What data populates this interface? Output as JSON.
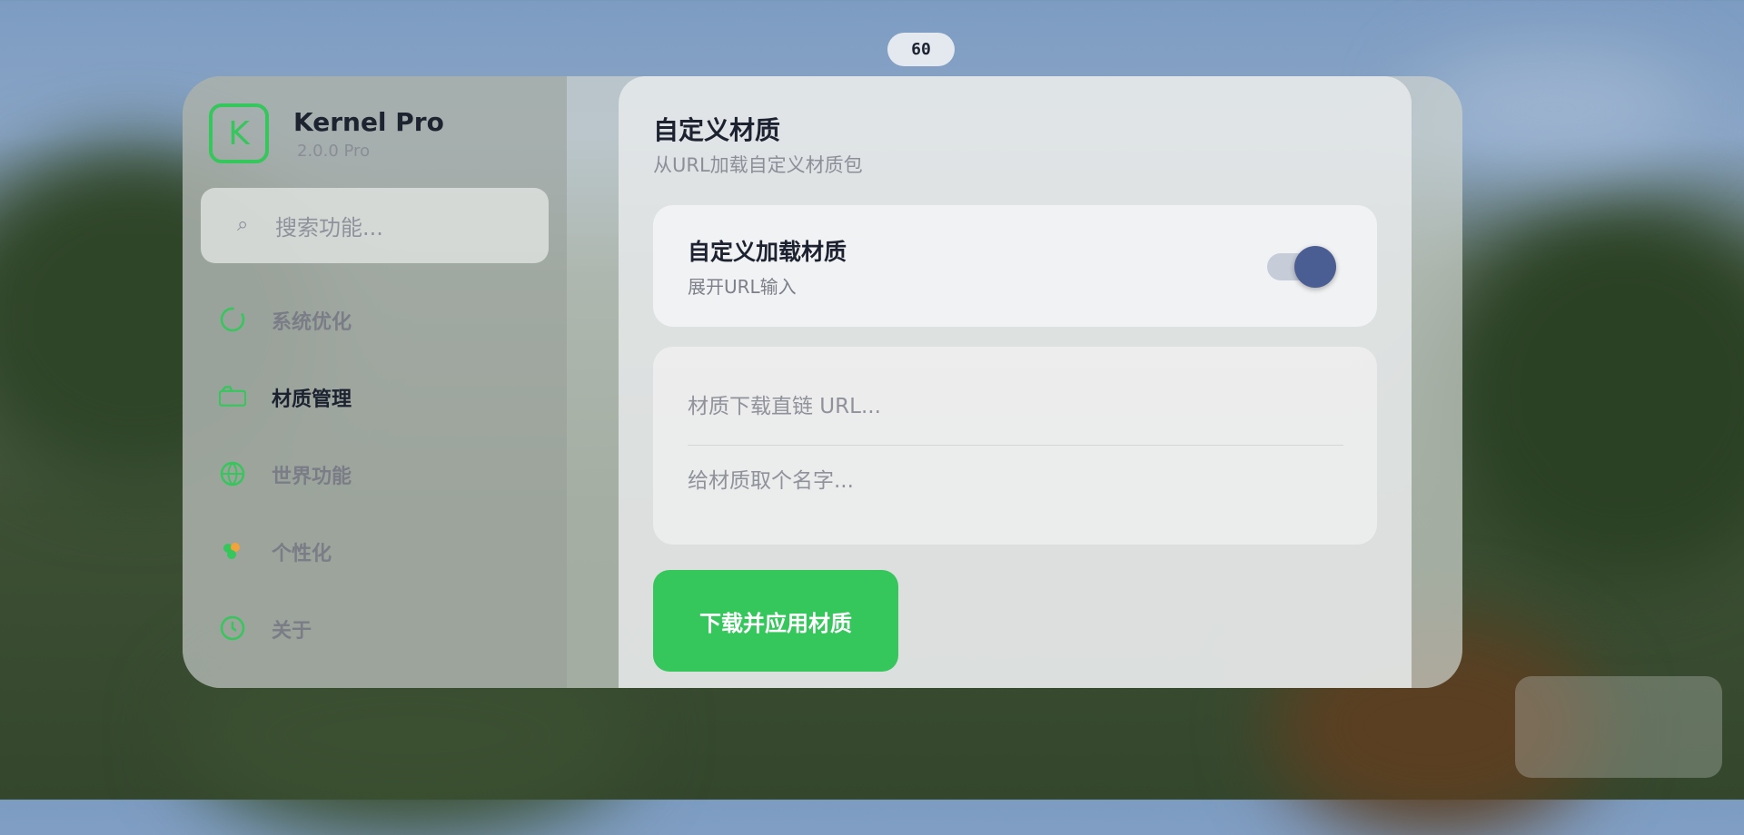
{
  "fps": "60",
  "app": {
    "logo_letter": "K",
    "name": "Kernel Pro",
    "version": "2.0.0 Pro"
  },
  "search": {
    "placeholder": "搜索功能..."
  },
  "nav": [
    {
      "label": "系统优化",
      "icon": "refresh-circle-icon",
      "active": false
    },
    {
      "label": "材质管理",
      "icon": "folder-icon",
      "active": true
    },
    {
      "label": "世界功能",
      "icon": "globe-icon",
      "active": false
    },
    {
      "label": "个性化",
      "icon": "palette-icon",
      "active": false
    },
    {
      "label": "关于",
      "icon": "clock-icon",
      "active": false
    }
  ],
  "panel": {
    "title": "自定义材质",
    "subtitle": "从URL加载自定义材质包",
    "toggle_card": {
      "title": "自定义加载材质",
      "subtitle": "展开URL输入",
      "enabled": true
    },
    "url_input": {
      "placeholder": "材质下载直链 URL..."
    },
    "name_input": {
      "placeholder": "给材质取个名字..."
    },
    "apply_button": "下载并应用材质"
  },
  "colors": {
    "accent_green": "#35c65c",
    "toggle_knob": "#4a5e93",
    "text_dark": "#1d2230"
  }
}
